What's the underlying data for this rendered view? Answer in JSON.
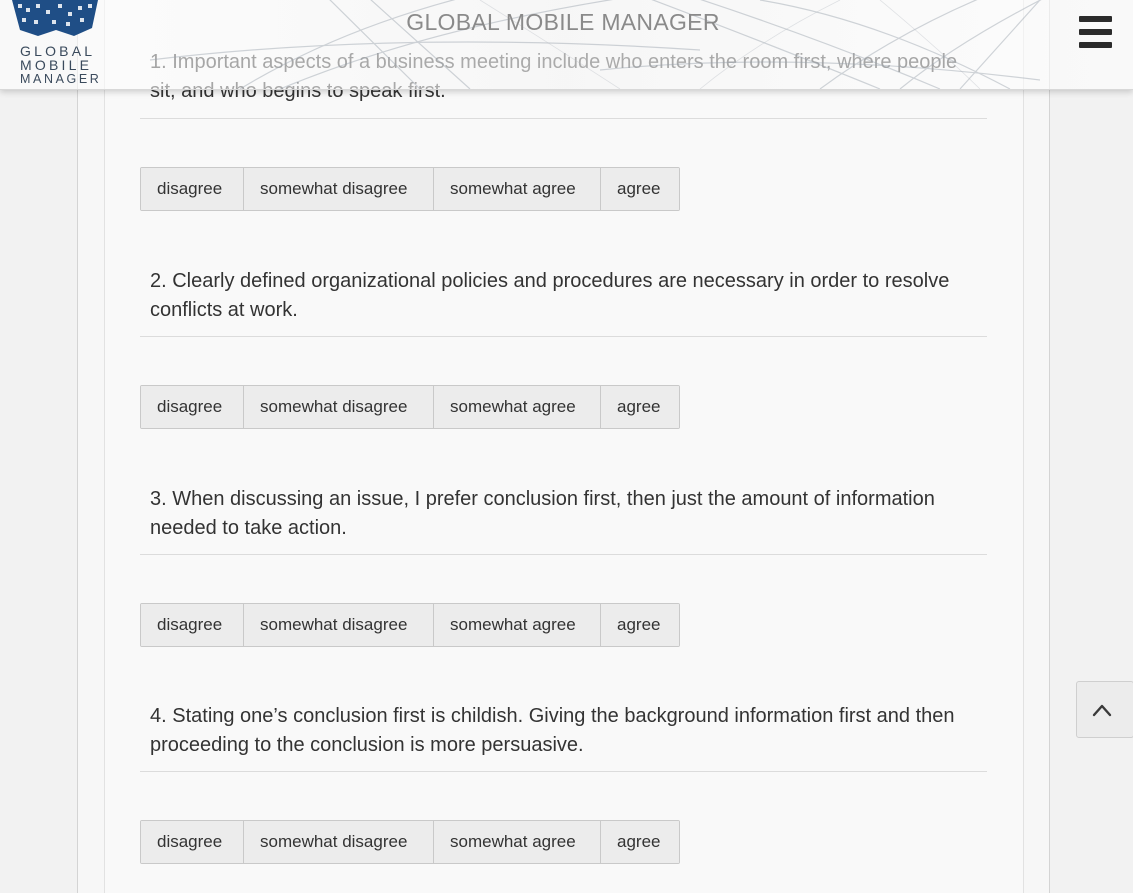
{
  "header": {
    "title": "GLOBAL MOBILE MANAGER",
    "logo": {
      "line1": "GLOBAL",
      "line2": "MOBILE",
      "line3": "MANAGER"
    },
    "menu_icon": "hamburger-menu-icon"
  },
  "options": [
    "disagree",
    "somewhat disagree",
    "somewhat agree",
    "agree"
  ],
  "questions": [
    {
      "text": "1. Important aspects of a business meeting include who enters the room first, where people sit, and who begins to speak first."
    },
    {
      "text": "2. Clearly defined organizational policies and procedures are necessary in order to resolve conflicts at work."
    },
    {
      "text": "3. When discussing an issue, I prefer conclusion first, then just the amount of information needed to take action."
    },
    {
      "text": "4. Stating one’s conclusion first is childish. Giving the background information first and then proceeding to the conclusion is more persuasive."
    }
  ],
  "scroll_top_icon": "chevron-up-icon"
}
